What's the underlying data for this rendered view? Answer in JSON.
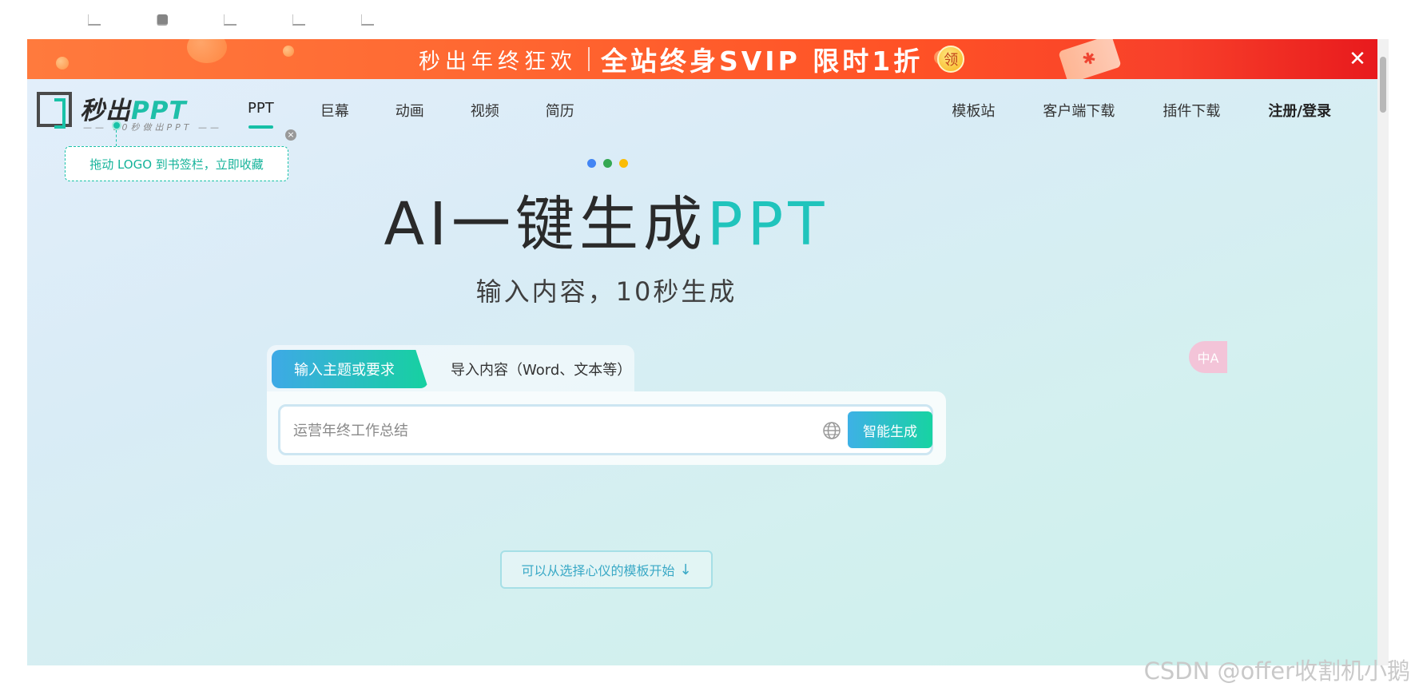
{
  "banner": {
    "text_a": "秒出年终狂欢",
    "text_b": "全站终身SVIP 限时1折",
    "coupon_label": "领",
    "close_icon": "close-icon"
  },
  "logo": {
    "name_cn": "秒出",
    "name_en": "PPT",
    "slogan": "10秒做出PPT"
  },
  "nav": {
    "left": [
      "PPT",
      "巨幕",
      "动画",
      "视频",
      "简历"
    ],
    "active": "PPT",
    "right": [
      "模板站",
      "客户端下载",
      "插件下载",
      "注册/登录"
    ]
  },
  "tooltip": {
    "text": "拖动 LOGO 到书签栏，立即收藏"
  },
  "hero": {
    "title_main": "AI一键生成",
    "title_accent": "PPT",
    "subtitle": "输入内容，10秒生成",
    "dot_colors": [
      "#4285f4",
      "#34a853",
      "#fbbc05"
    ]
  },
  "input_panel": {
    "tab_active": "输入主题或要求",
    "tab_inactive": "导入内容（Word、文本等）",
    "placeholder": "运营年终工作总结",
    "value": "",
    "generate_label": "智能生成"
  },
  "template_hint": {
    "label": "可以从选择心仪的模板开始",
    "arrow": "↓"
  },
  "translate_fab": {
    "label": "中A"
  },
  "watermark": "CSDN @offer收割机小鹅",
  "colors": {
    "accent": "#16bfa6",
    "banner_start": "#ff7a3d",
    "banner_end": "#e81a1d"
  }
}
